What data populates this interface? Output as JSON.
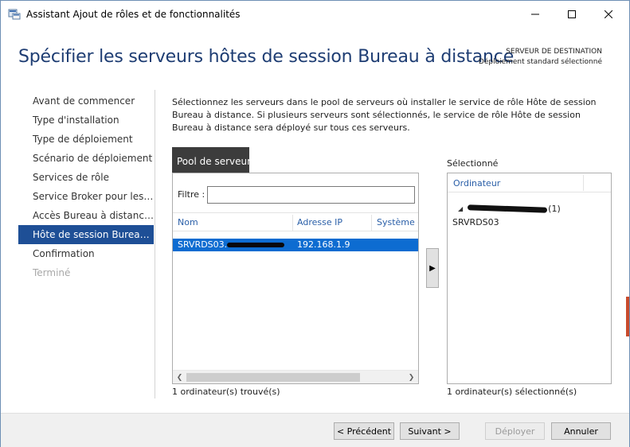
{
  "window": {
    "title": "Assistant Ajout de rôles et de fonctionnalités"
  },
  "header": {
    "title": "Spécifier les serveurs hôtes de session Bureau à distance",
    "destination_label": "SERVEUR DE DESTINATION",
    "destination_value": "Déploiement standard sélectionné"
  },
  "nav": {
    "items": [
      {
        "label": "Avant de commencer",
        "state": "normal"
      },
      {
        "label": "Type d'installation",
        "state": "normal"
      },
      {
        "label": "Type de déploiement",
        "state": "normal"
      },
      {
        "label": "Scénario de déploiement",
        "state": "normal"
      },
      {
        "label": "Services de rôle",
        "state": "normal"
      },
      {
        "label": "Service Broker pour les c...",
        "state": "normal"
      },
      {
        "label": "Accès Bureau à distance...",
        "state": "normal"
      },
      {
        "label": "Hôte de session Bureau à...",
        "state": "active"
      },
      {
        "label": "Confirmation",
        "state": "normal"
      },
      {
        "label": "Terminé",
        "state": "disabled"
      }
    ]
  },
  "intro_text": "Sélectionnez les serveurs dans le pool de serveurs où installer le service de rôle Hôte de session Bureau à distance. Si plusieurs serveurs sont sélectionnés, le service de rôle Hôte de session Bureau à distance sera déployé sur tous ces serveurs.",
  "pool": {
    "tab_label": "Pool de serveurs",
    "filter_label": "Filtre :",
    "filter_value": "",
    "columns": [
      "Nom",
      "Adresse IP",
      "Système d"
    ],
    "rows": [
      {
        "name": "SRVRDS03.",
        "ip": "192.168.1.9",
        "os": ""
      }
    ],
    "found_text": "1 ordinateur(s) trouvé(s)"
  },
  "selected": {
    "label": "Sélectionné",
    "column": "Ordinateur",
    "group_count": "(1)",
    "servers": [
      "SRVRDS03"
    ],
    "count_text": "1 ordinateur(s) sélectionné(s)"
  },
  "add_arrow": "▶",
  "footer": {
    "prev": "< Précédent",
    "next": "Suivant >",
    "deploy": "Déployer",
    "cancel": "Annuler"
  },
  "colors": {
    "accent": "#1e4f96",
    "selection": "#0d6cd1",
    "title_blue": "#1e3d73"
  }
}
